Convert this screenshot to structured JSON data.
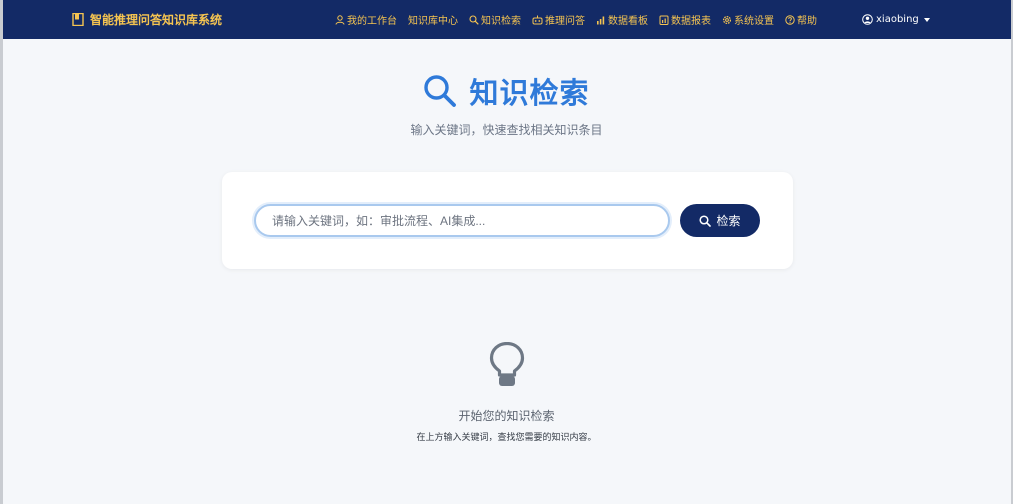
{
  "navbar": {
    "brand": "智能推理问答知识库系统",
    "items": [
      {
        "icon": "user-icon",
        "label": "我的工作台"
      },
      {
        "icon": "",
        "label": "知识库中心"
      },
      {
        "icon": "search-icon",
        "label": "知识检索"
      },
      {
        "icon": "robot-icon",
        "label": "推理问答"
      },
      {
        "icon": "bar-chart-icon",
        "label": "数据看板"
      },
      {
        "icon": "report-icon",
        "label": "数据报表"
      },
      {
        "icon": "gear-icon",
        "label": "系统设置"
      },
      {
        "icon": "help-icon",
        "label": "帮助"
      }
    ],
    "user": "xiaobing"
  },
  "main": {
    "title": "知识检索",
    "subtitle": "输入关键词，快速查找相关知识条目"
  },
  "search": {
    "placeholder": "请输入关键词，如：审批流程、AI集成...",
    "value": "",
    "button": "检索"
  },
  "empty_state": {
    "icon": "lightbulb-icon",
    "title": "开始您的知识检索",
    "hint": "在上方输入关键词，查找您需要的知识内容。"
  },
  "colors": {
    "navbar": "#132a66",
    "nav_text": "#f5c451",
    "accent": "#2f7ad9",
    "background": "#f5f7fa"
  }
}
